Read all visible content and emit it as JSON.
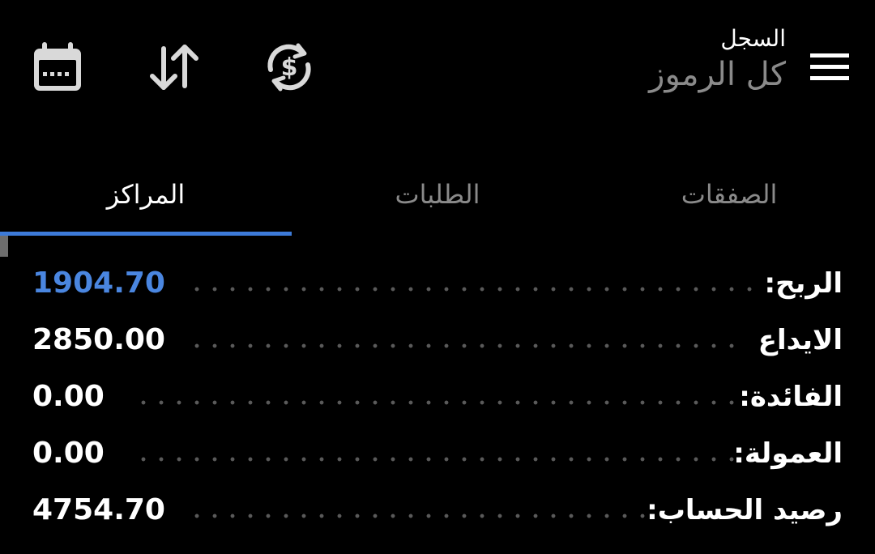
{
  "header": {
    "title": "السجل",
    "subtitle": "كل الرموز"
  },
  "toolbar": {
    "icons": [
      "menu-icon",
      "currency-exchange-icon",
      "sort-icon",
      "calendar-icon"
    ]
  },
  "tabs": [
    {
      "label": "الصفقات",
      "active": false
    },
    {
      "label": "الطلبات",
      "active": false
    },
    {
      "label": "المراكز",
      "active": true
    }
  ],
  "summary": [
    {
      "label": "الربح:",
      "value": "1904.70",
      "highlight": true
    },
    {
      "label": "الايداع",
      "value": "2850.00",
      "highlight": false
    },
    {
      "label": "الفائدة:",
      "value": "0.00",
      "highlight": false
    },
    {
      "label": "العمولة:",
      "value": "0.00",
      "highlight": false
    },
    {
      "label": "رصيد الحساب:",
      "value": "4754.70",
      "highlight": false
    }
  ],
  "colors": {
    "background": "#000000",
    "accent": "#3d7bd9",
    "profit": "#4a86e0",
    "muted_text": "#8a8a8a"
  }
}
